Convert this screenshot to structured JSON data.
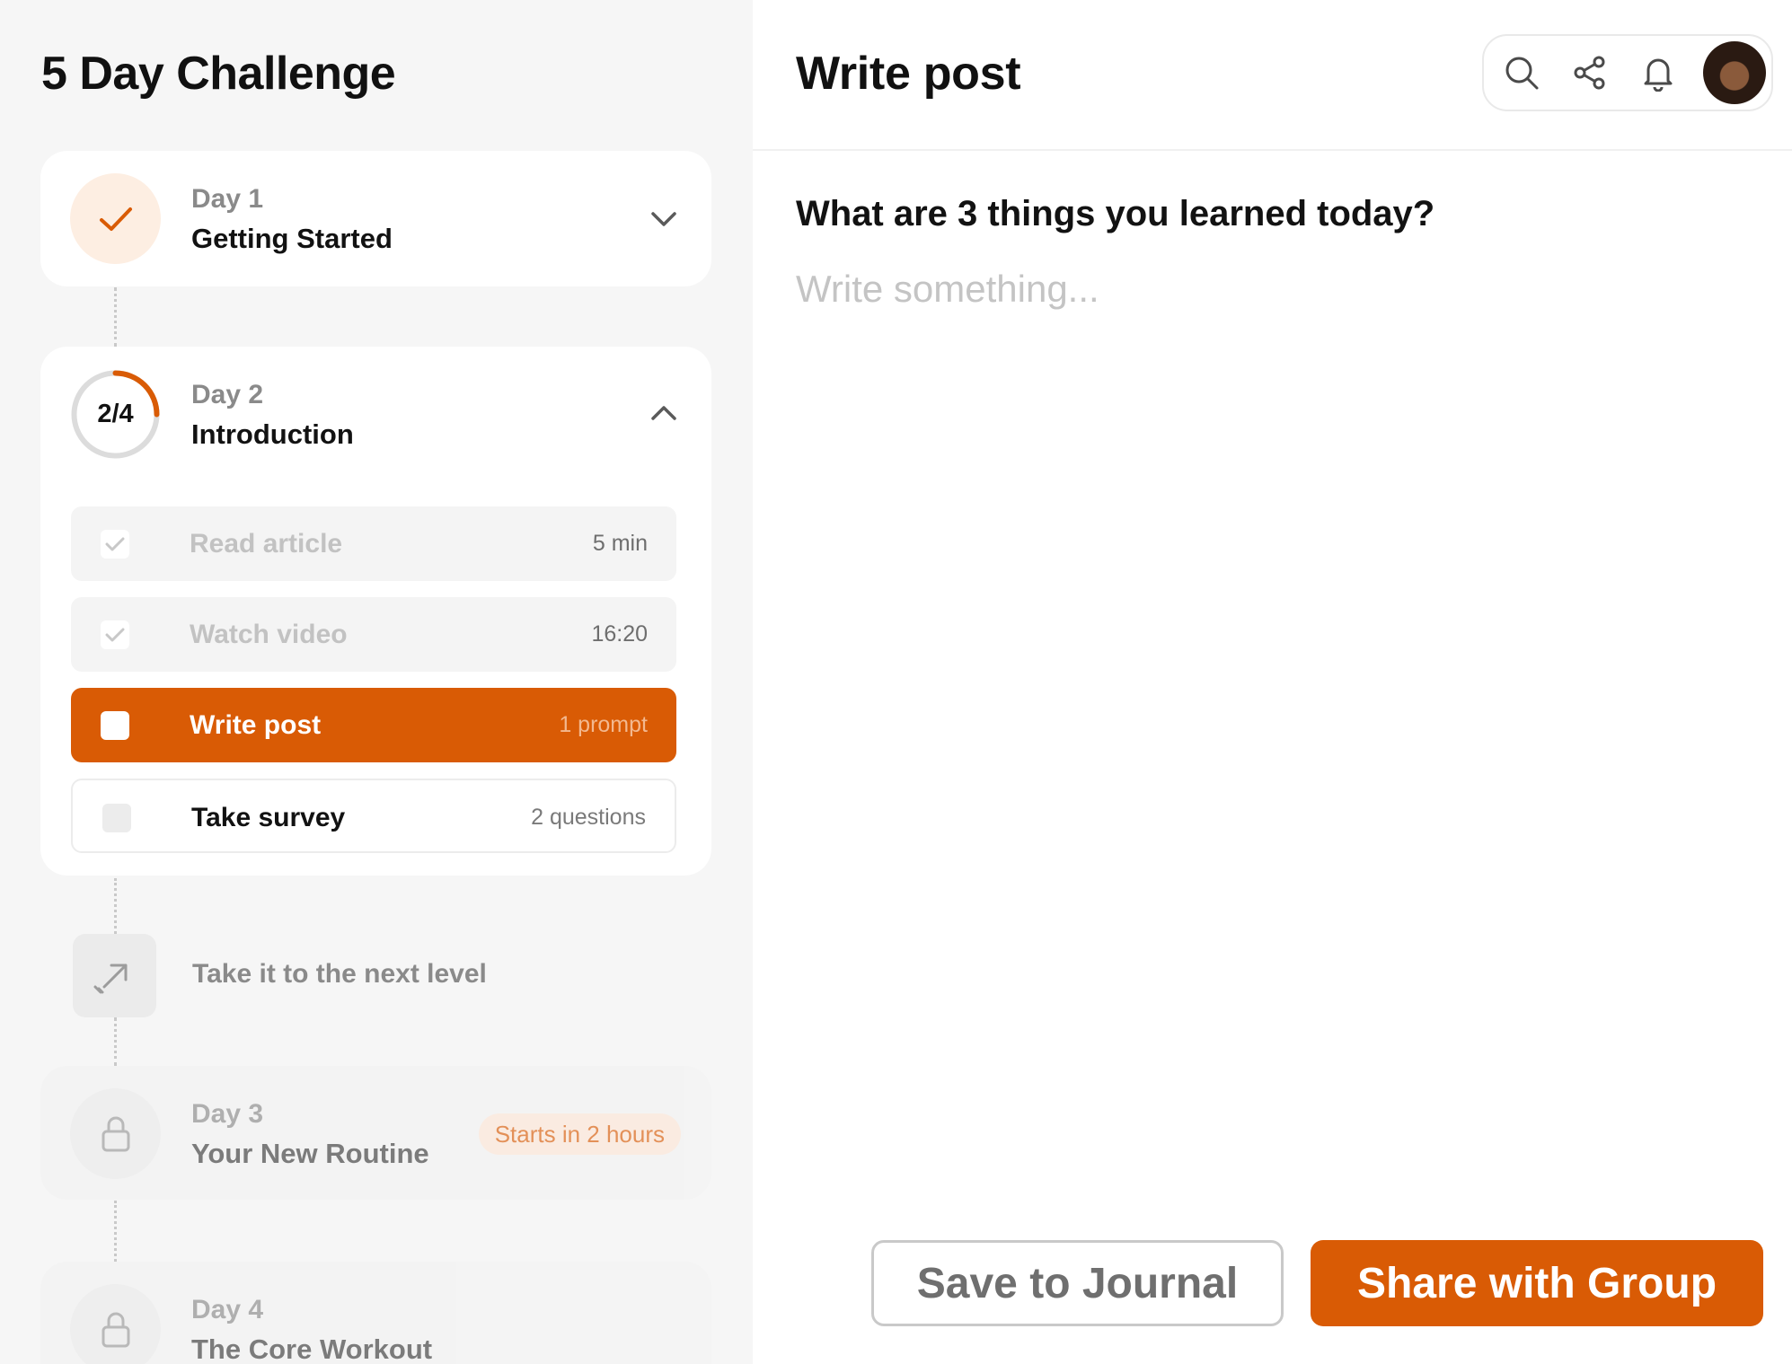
{
  "sidebar": {
    "title": "5 Day Challenge",
    "days": [
      {
        "day": "Day 1",
        "name": "Getting Started",
        "status": "completed",
        "icon": "check-icon",
        "toggle_icon": "chevron-down-icon"
      },
      {
        "day": "Day 2",
        "name": "Introduction",
        "status": "in-progress",
        "progress": "2/4",
        "progress_fraction": 0.25,
        "toggle_icon": "chevron-up-icon",
        "tasks": [
          {
            "name": "Read article",
            "meta": "5 min",
            "state": "completed"
          },
          {
            "name": "Watch video",
            "meta": "16:20",
            "state": "completed"
          },
          {
            "name": "Write post",
            "meta": "1 prompt",
            "state": "active"
          },
          {
            "name": "Take survey",
            "meta": "2 questions",
            "state": "todo"
          }
        ]
      },
      {
        "day": "Day 3",
        "name": "Your New Routine",
        "status": "locked",
        "icon": "lock-icon",
        "badge": "Starts in 2 hours"
      },
      {
        "day": "Day 4",
        "name": "The Core Workout",
        "status": "locked",
        "icon": "lock-icon"
      }
    ],
    "next_level": {
      "label": "Take it to the next level",
      "icon": "arrow-up-right-icon"
    }
  },
  "header": {
    "title": "Write post",
    "tools": [
      "search-icon",
      "share-icon",
      "bell-icon",
      "avatar"
    ]
  },
  "editor": {
    "question": "What are 3 things you learned today?",
    "placeholder": "Write something...",
    "value": ""
  },
  "actions": {
    "save_label": "Save to Journal",
    "share_label": "Share with Group"
  },
  "colors": {
    "accent": "#d95b05",
    "accent_soft": "#fdeee2",
    "sidebar_bg": "#f6f6f6",
    "card_bg": "#ffffff"
  }
}
